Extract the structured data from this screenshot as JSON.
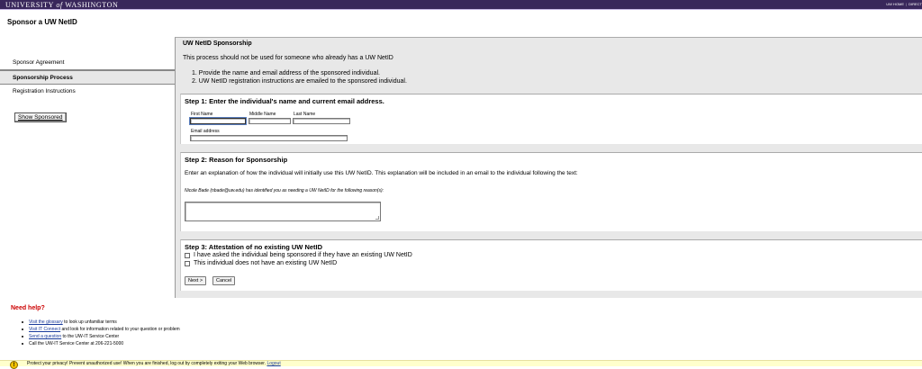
{
  "header": {
    "university_prefix": "UNIVERSITY",
    "university_of": "of",
    "university_suffix": "WASHINGTON",
    "links": [
      "UW HOME",
      "DIRECT"
    ]
  },
  "app_title": "Sponsor a UW NetID",
  "sidebar": {
    "items": [
      {
        "label": "Sponsor Agreement"
      },
      {
        "label": "Sponsorship Process"
      },
      {
        "label": "Registration Instructions"
      }
    ],
    "show_sponsored": "Show Sponsored"
  },
  "main": {
    "heading": "UW NetID Sponsorship",
    "intro": "This process should not be used for someone who already has a UW NetID",
    "steps": [
      "1. Provide the name and email address of the sponsored individual.",
      "2. UW NetID registration instructions are emailed to the sponsored individual."
    ],
    "step1": {
      "heading": "Step 1: Enter the individual's name and current email address.",
      "first_name_label": "First Name",
      "middle_name_label": "Middle Name",
      "last_name_label": "Last Name",
      "email_label": "Email address",
      "first_name_value": "",
      "middle_name_value": "",
      "last_name_value": "",
      "email_value": ""
    },
    "step2": {
      "heading": "Step 2: Reason for Sponsorship",
      "text": "Enter an explanation of how the individual will initially use this UW NetID. This explanation will be included in an email to the individual following the text:",
      "note": "Nicole Bade (nbade@uw.edu) has identified you as needing a UW NetID for the following reason(s):",
      "reason_value": ""
    },
    "step3": {
      "heading": "Step 3: Attestation of no existing UW NetID",
      "option1": "I have asked the individual being sponsored if they have an existing UW NetID",
      "option2": "This individual does not have an existing UW NetID",
      "option1_checked": false,
      "option2_checked": false
    },
    "buttons": {
      "next": "Next >",
      "cancel": "Cancel"
    }
  },
  "help": {
    "heading": "Need help?",
    "items": [
      {
        "link": "Visit the glossary",
        "text": " to look up unfamiliar terms"
      },
      {
        "link": "Visit IT Connect",
        "text": " and look for information related to your question or problem"
      },
      {
        "link": "Send a question",
        "text": " to the UW-IT Service Center"
      },
      {
        "link": "",
        "text": "Call the UW-IT Service Center at 206-221-5000"
      }
    ]
  },
  "privacy": {
    "icon": "warning-icon",
    "message": "Protect your privacy! Prevent unauthorized use! When you are finished, log out by completely exiting your Web browser.",
    "logout_link": "Logout"
  },
  "colors": {
    "brand_purple": "#39275b",
    "help_red": "#cc0000",
    "panel_gray": "#e8e8e8",
    "privacy_yellow": "#ffffcc",
    "link_blue": "#1a3c9c"
  }
}
